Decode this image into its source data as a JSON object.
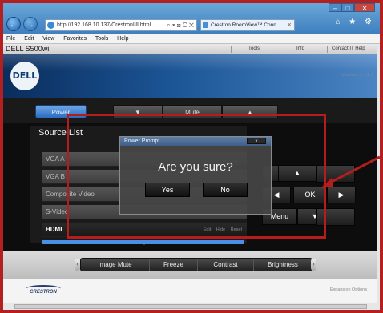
{
  "browser": {
    "address": "http://192.168.10.137/CrestronUI.html",
    "address_tools": "⌕ ▾ ⊠ C ✕",
    "tab_title": "Crestron RoomView™ Conn...",
    "tab_close": "✕",
    "window_controls": [
      "–",
      "□",
      "✕"
    ],
    "chrome_icons": "⌂ ★ ⚙",
    "back_icon": "←",
    "forward_icon": "→",
    "menu": [
      "File",
      "Edit",
      "View",
      "Favorites",
      "Tools",
      "Help"
    ]
  },
  "page": {
    "device_name": "DELL S500wi",
    "top_links": [
      "Tools",
      "Info",
      "Contact IT Help"
    ],
    "logo_text": "DELL",
    "power_label": "Power",
    "mute_label": "Mute",
    "down_glyph": "▼",
    "up_glyph": "▲",
    "interface_version": "Interface 2.7.2.1"
  },
  "source_list": {
    "title": "Source List",
    "items": [
      "VGA A",
      "VGA B",
      "Composite Video",
      "S-Video",
      "HDMI"
    ],
    "selected": "HDMI",
    "row_actions": [
      "Edit",
      "Hide",
      "Reset"
    ]
  },
  "dpad": {
    "up": "▲",
    "left": "◀",
    "ok": "OK",
    "right": "▶",
    "menu": "Menu",
    "down": "▼"
  },
  "toolbar": {
    "buttons": [
      "Image Mute",
      "Freeze",
      "Contrast",
      "Brightness"
    ],
    "left_cap": "‹",
    "right_cap": "›"
  },
  "footer": {
    "brand": "CRESTRON",
    "expansion": "Expansion Options"
  },
  "dialog": {
    "title": "Power Prompt",
    "close": "x",
    "question": "Are you sure?",
    "yes": "Yes",
    "no": "No"
  },
  "colors": {
    "annotation_red": "#b51d1d",
    "dell_blue": "#1c5596",
    "power_blue": "#2a6cc2"
  }
}
